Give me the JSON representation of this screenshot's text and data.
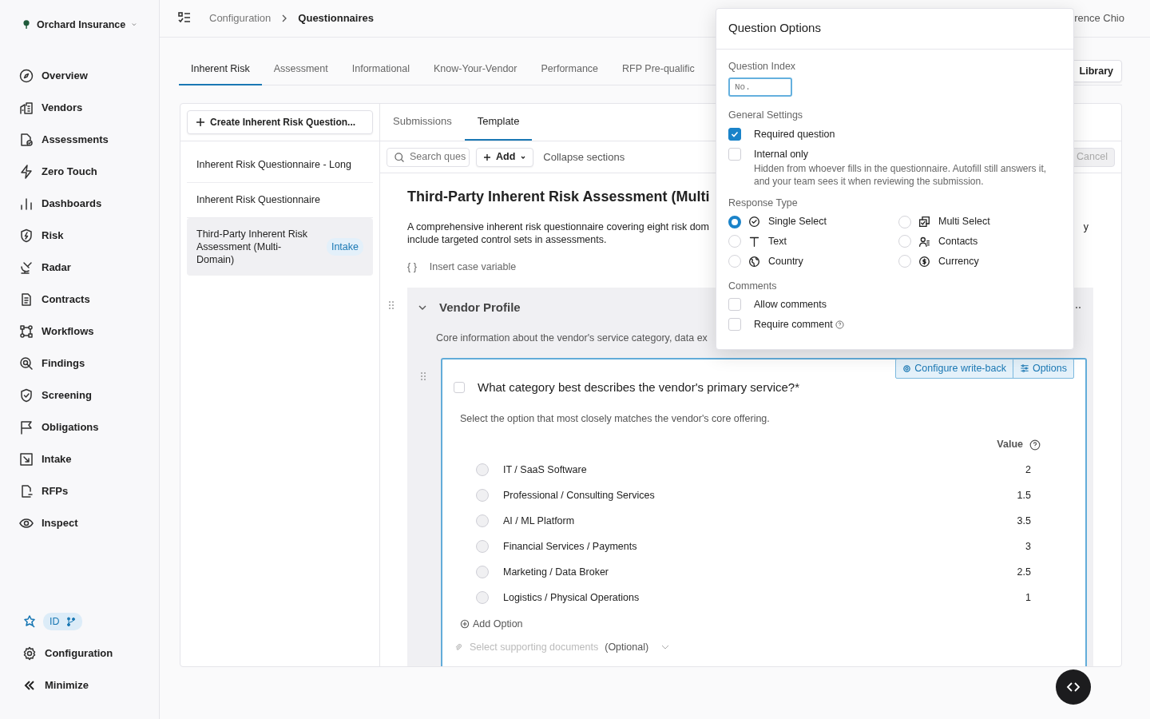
{
  "org": {
    "name": "Orchard Insurance"
  },
  "sidebar": {
    "items": [
      {
        "label": "Overview"
      },
      {
        "label": "Vendors"
      },
      {
        "label": "Assessments"
      },
      {
        "label": "Zero Touch"
      },
      {
        "label": "Dashboards"
      },
      {
        "label": "Risk"
      },
      {
        "label": "Radar"
      },
      {
        "label": "Contracts"
      },
      {
        "label": "Workflows"
      },
      {
        "label": "Findings"
      },
      {
        "label": "Screening"
      },
      {
        "label": "Obligations"
      },
      {
        "label": "Intake"
      },
      {
        "label": "RFPs"
      },
      {
        "label": "Inspect"
      }
    ],
    "env_badge": {
      "label": "ID"
    },
    "bottom": [
      {
        "label": "Configuration"
      },
      {
        "label": "Minimize"
      }
    ]
  },
  "breadcrumb": [
    "Configuration",
    "Questionnaires"
  ],
  "user": {
    "name": "rence Chio"
  },
  "top_tabs": [
    {
      "label": "Inherent Risk",
      "selected": true
    },
    {
      "label": "Assessment",
      "selected": false
    },
    {
      "label": "Informational",
      "selected": false
    },
    {
      "label": "Know-Your-Vendor",
      "selected": false
    },
    {
      "label": "Performance",
      "selected": false
    },
    {
      "label": "RFP Pre-qualific",
      "selected": false
    }
  ],
  "library_button": "Library",
  "create_button": "Create Inherent Risk Question...",
  "questionnaires": [
    {
      "title": "Inherent Risk Questionnaire - Long",
      "selected": false
    },
    {
      "title": "Inherent Risk Questionnaire",
      "selected": false
    },
    {
      "title": "Third-Party Inherent Risk Assessment (Multi-Domain)",
      "badge": "Intake",
      "selected": true
    }
  ],
  "sub_tabs": [
    {
      "label": "Submissions",
      "selected": false
    },
    {
      "label": "Template",
      "selected": true
    }
  ],
  "toolbar": {
    "search_placeholder": "Search ques",
    "add_button": "Add",
    "collapse": "Collapse sections",
    "cancel": "Cancel"
  },
  "template": {
    "title": "Third-Party Inherent Risk Assessment (Multi",
    "description_lines": [
      "A comprehensive inherent risk questionnaire covering eight risk dom",
      "include targeted control sets in assessments."
    ],
    "description_tail": "y",
    "variable_glyph": "{ }",
    "variable_link": "Insert case variable"
  },
  "section": {
    "title": "Vendor Profile",
    "expanded": true,
    "description": "Core information about the vendor's service category, data ex"
  },
  "question": {
    "text": "What category best describes the vendor's primary service?*",
    "selected": false,
    "help": "Select the option that most closely matches the vendor's core offering.",
    "value_header": "Value",
    "options": [
      {
        "label": "IT / SaaS Software",
        "value": "2",
        "selected": false
      },
      {
        "label": "Professional / Consulting Services",
        "value": "1.5",
        "selected": false
      },
      {
        "label": "AI / ML Platform",
        "value": "3.5",
        "selected": false
      },
      {
        "label": "Financial Services / Payments",
        "value": "3",
        "selected": false
      },
      {
        "label": "Marketing / Data Broker",
        "value": "2.5",
        "selected": false
      },
      {
        "label": "Logistics / Physical Operations",
        "value": "1",
        "selected": false
      }
    ],
    "add_option": "Add Option",
    "documents": {
      "placeholder": "Select supporting documents",
      "optional": "(Optional)"
    },
    "write_back_button": "Configure write-back",
    "options_button": "Options"
  },
  "popover": {
    "title": "Question Options",
    "index": {
      "label": "Question Index",
      "placeholder": "No."
    },
    "general": {
      "heading": "General Settings",
      "items": [
        {
          "label": "Required question",
          "checked": true
        },
        {
          "label": "Internal only",
          "checked": false,
          "hint": "Hidden from whoever fills in the questionnaire. Autofill still answers it, and your team sees it when reviewing the submission."
        }
      ]
    },
    "response": {
      "heading": "Response Type",
      "items": [
        {
          "label": "Single Select",
          "selected": true
        },
        {
          "label": "Multi Select",
          "selected": false
        },
        {
          "label": "Text",
          "selected": false
        },
        {
          "label": "Contacts",
          "selected": false
        },
        {
          "label": "Country",
          "selected": false
        },
        {
          "label": "Currency",
          "selected": false
        }
      ]
    },
    "comments": {
      "heading": "Comments",
      "items": [
        {
          "label": "Allow comments",
          "checked": false,
          "help": false
        },
        {
          "label": "Require comment",
          "checked": false,
          "help": true
        }
      ]
    }
  }
}
